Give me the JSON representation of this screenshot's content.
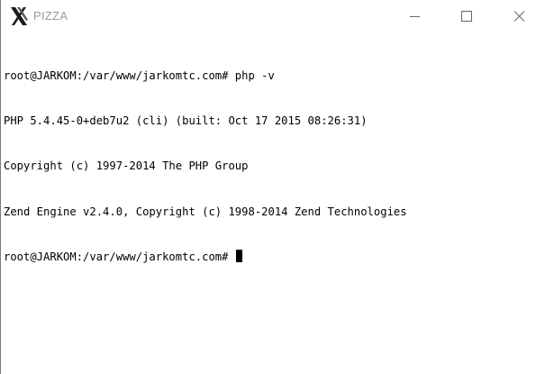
{
  "window": {
    "title": "PIZZA",
    "controls": {
      "minimize_icon": "minimize-icon",
      "maximize_icon": "maximize-icon",
      "close_icon": "close-icon"
    }
  },
  "terminal": {
    "lines": [
      "root@JARKOM:/var/www/jarkomtc.com# php -v",
      "PHP 5.4.45-0+deb7u2 (cli) (built: Oct 17 2015 08:26:31)",
      "Copyright (c) 1997-2014 The PHP Group",
      "Zend Engine v2.4.0, Copyright (c) 1998-2014 Zend Technologies"
    ],
    "prompt": "root@JARKOM:/var/www/jarkomtc.com# ",
    "colors": {
      "background": "#ffffff",
      "foreground": "#000000"
    }
  }
}
